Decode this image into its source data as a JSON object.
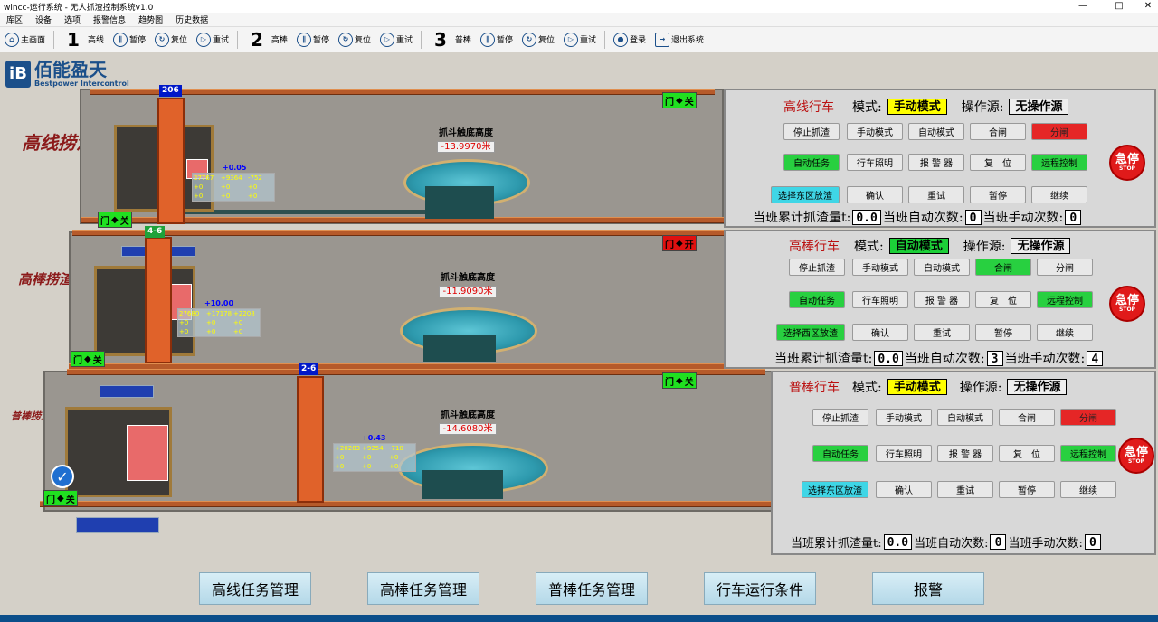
{
  "window": {
    "title": "wincc-运行系统 - 无人抓渣控制系统v1.0",
    "maximize": "□",
    "close": "✕",
    "minimize": "—"
  },
  "menu": [
    "库区",
    "设备",
    "选项",
    "报警信息",
    "趋势图",
    "历史数据"
  ],
  "toolbar": {
    "home": "主画面",
    "groups": [
      {
        "num": "1",
        "name": "高线",
        "pause": "暂停",
        "reset": "复位",
        "retry": "重试"
      },
      {
        "num": "2",
        "name": "高棒",
        "pause": "暂停",
        "reset": "复位",
        "retry": "重试"
      },
      {
        "num": "3",
        "name": "普棒",
        "pause": "暂停",
        "reset": "复位",
        "retry": "重试"
      }
    ],
    "login": "登录",
    "exit": "退出系统"
  },
  "logo": {
    "mark": "iB",
    "title": "佰能盈天",
    "subtitle": "Bestpower Intercontrol"
  },
  "lines": [
    {
      "label": "高线捞渣",
      "crane_tag": "206",
      "height_label": "抓斗触底高度",
      "height_value": "-13.9970米",
      "door_left": {
        "text": "门",
        "state": "关"
      },
      "door_right": {
        "text": "门",
        "state": "关"
      },
      "offset": "+0.05",
      "coords": [
        "27767",
        "+9364",
        "-752",
        "+0",
        "+0",
        "+0",
        "+0",
        "+0",
        "+0"
      ]
    },
    {
      "label": "高棒捞渣",
      "crane_tag": "4-6",
      "height_label": "抓斗触底高度",
      "height_value": "-11.9090米",
      "door_left": {
        "text": "门",
        "state": "关"
      },
      "door_right": {
        "text": "门",
        "state": "开"
      },
      "offset": "+10.00",
      "coords": [
        "27680",
        "+17178",
        "+2208",
        "+0",
        "+0",
        "+0",
        "+0",
        "+0",
        "+0"
      ]
    },
    {
      "label": "普棒捞渣",
      "crane_tag": "2-6",
      "height_label": "抓斗触底高度",
      "height_value": "-14.6080米",
      "door_left": {
        "text": "门",
        "state": "关"
      },
      "door_right": {
        "text": "门",
        "state": "关"
      },
      "offset": "+0.43",
      "coords": [
        "+20283",
        "+9254",
        "-710",
        "+0",
        "+0",
        "+0",
        "+0",
        "+0",
        "+0"
      ]
    }
  ],
  "panels": [
    {
      "name": "高线行车",
      "mode_label": "模式:",
      "mode": "手动模式",
      "mode_color": "yellow",
      "source_label": "操作源:",
      "source": "无操作源",
      "buttons_row1": [
        "停止抓渣",
        "手动模式",
        "自动模式",
        "合闸",
        "分闸"
      ],
      "buttons_row2": [
        "自动任务",
        "行车照明",
        "报 警 器",
        "复　位",
        "远程控制"
      ],
      "buttons_row3": [
        "选择东区放渣",
        "确认",
        "重试",
        "暂停",
        "继续"
      ],
      "estop": "急停",
      "estop_sub": "STOP",
      "count_total_label": "当班累计抓渣量t:",
      "count_total": "0.0",
      "count_auto_label": "当班自动次数:",
      "count_auto": "0",
      "count_manual_label": "当班手动次数:",
      "count_manual": "0"
    },
    {
      "name": "高棒行车",
      "mode_label": "模式:",
      "mode": "自动模式",
      "mode_color": "green",
      "source_label": "操作源:",
      "source": "无操作源",
      "buttons_row1": [
        "停止抓渣",
        "手动模式",
        "自动模式",
        "合闸",
        "分闸"
      ],
      "buttons_row2": [
        "自动任务",
        "行车照明",
        "报 警 器",
        "复　位",
        "远程控制"
      ],
      "buttons_row3": [
        "选择西区放渣",
        "确认",
        "重试",
        "暂停",
        "继续"
      ],
      "estop": "急停",
      "estop_sub": "STOP",
      "count_total_label": "当班累计抓渣量t:",
      "count_total": "0.0",
      "count_auto_label": "当班自动次数:",
      "count_auto": "3",
      "count_manual_label": "当班手动次数:",
      "count_manual": "4"
    },
    {
      "name": "普棒行车",
      "mode_label": "模式:",
      "mode": "手动模式",
      "mode_color": "yellow",
      "source_label": "操作源:",
      "source": "无操作源",
      "buttons_row1": [
        "停止抓渣",
        "手动模式",
        "自动模式",
        "合闸",
        "分闸"
      ],
      "buttons_row2": [
        "自动任务",
        "行车照明",
        "报 警 器",
        "复　位",
        "远程控制"
      ],
      "buttons_row3": [
        "选择东区放渣",
        "确认",
        "重试",
        "暂停",
        "继续"
      ],
      "estop": "急停",
      "estop_sub": "STOP",
      "count_total_label": "当班累计抓渣量t:",
      "count_total": "0.0",
      "count_auto_label": "当班自动次数:",
      "count_auto": "0",
      "count_manual_label": "当班手动次数:",
      "count_manual": "0"
    }
  ],
  "bottom_buttons": [
    "高线任务管理",
    "高棒任务管理",
    "普棒任务管理",
    "行车运行条件",
    "报警"
  ],
  "colors": {
    "accent": "#1b4f8a",
    "crane": "#e0622a",
    "door_closed": "#20e020",
    "door_open": "#e01010"
  }
}
